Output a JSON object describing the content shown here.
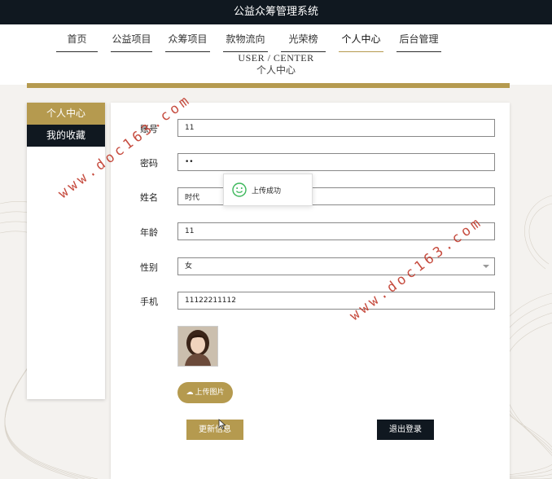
{
  "app": {
    "title": "公益众筹管理系统"
  },
  "nav": {
    "items": [
      {
        "label": "首页"
      },
      {
        "label": "公益项目"
      },
      {
        "label": "众筹项目"
      },
      {
        "label": "款物流向"
      },
      {
        "label": "光荣榜"
      },
      {
        "label": "个人中心"
      },
      {
        "label": "后台管理"
      }
    ],
    "active": "个人中心"
  },
  "page_header": {
    "en": "USER / CENTER",
    "cn": "个人中心"
  },
  "sidebar": {
    "items": [
      {
        "label": "个人中心"
      },
      {
        "label": "我的收藏"
      }
    ]
  },
  "form": {
    "account": {
      "label": "账号",
      "value": "11"
    },
    "password": {
      "label": "密码",
      "value": "••"
    },
    "name": {
      "label": "姓名",
      "value": "时代"
    },
    "age": {
      "label": "年龄",
      "value": "11"
    },
    "gender": {
      "label": "性别",
      "value": "女"
    },
    "phone": {
      "label": "手机",
      "value": "11122211112"
    }
  },
  "buttons": {
    "upload": "上传图片",
    "update": "更新信息",
    "logout": "退出登录"
  },
  "toast": {
    "text": "上传成功"
  },
  "watermark": {
    "text": "www.doc163.com"
  },
  "colors": {
    "gold": "#b59a4f",
    "dark": "#101820",
    "toast_icon": "#3bb75a",
    "watermark": "#c0392b"
  },
  "icons": {
    "upload": "cloud-upload-icon",
    "toast": "smile-check-icon",
    "select": "chevron-down-icon"
  }
}
